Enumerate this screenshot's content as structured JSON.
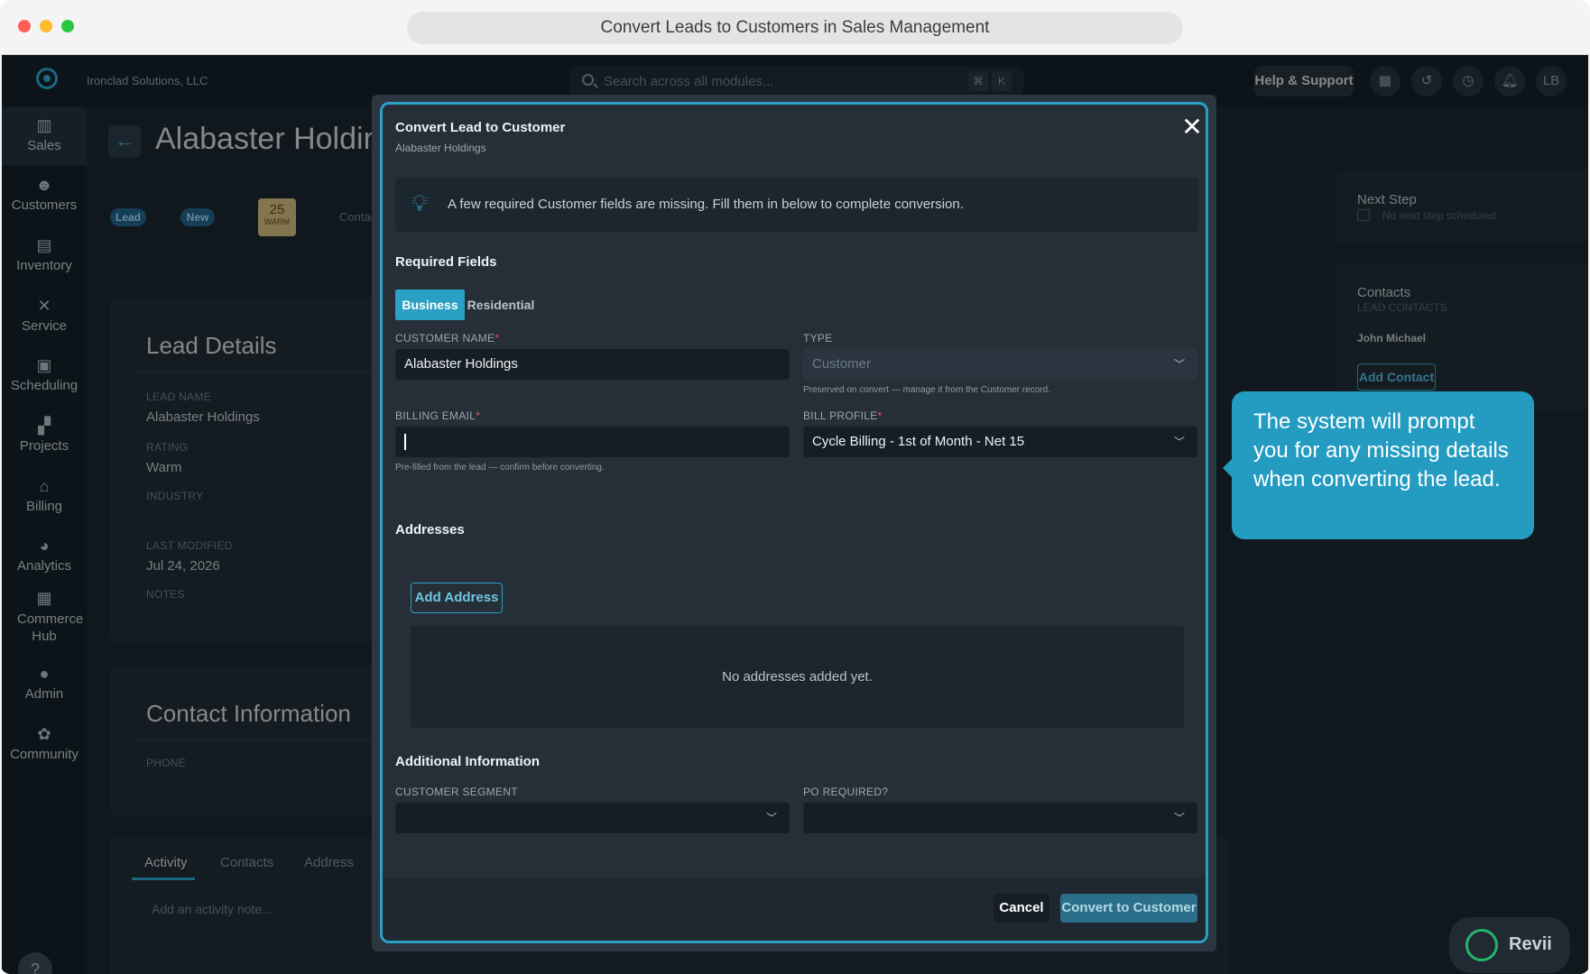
{
  "window": {
    "title": "Convert Leads to Customers in Sales Management"
  },
  "topbar": {
    "company": "Ironclad Solutions, LLC",
    "search_placeholder": "Search across all modules...",
    "kbd_cmd": "⌘",
    "kbd_k": "K",
    "help_label": "Help & Support",
    "avatar_initials": "LB"
  },
  "sidebar": {
    "items": [
      {
        "label": "Sales",
        "icon": "sales-icon"
      },
      {
        "label": "Customers",
        "icon": "customers-icon"
      },
      {
        "label": "Inventory",
        "icon": "inventory-icon"
      },
      {
        "label": "Service",
        "icon": "service-icon"
      },
      {
        "label": "Scheduling",
        "icon": "calendar-icon"
      },
      {
        "label": "Projects",
        "icon": "projects-icon"
      },
      {
        "label": "Billing",
        "icon": "bank-icon"
      },
      {
        "label": "Analytics",
        "icon": "pie-chart-icon"
      },
      {
        "label": "Commerce Hub",
        "icon": "store-icon"
      },
      {
        "label": "Admin",
        "icon": "admin-icon"
      },
      {
        "label": "Community",
        "icon": "community-icon"
      }
    ],
    "help": "?"
  },
  "page": {
    "title": "Alabaster Holdings",
    "badges": {
      "lead": "Lead",
      "new": "New"
    },
    "score": {
      "value": "25",
      "label": "WARM"
    },
    "contact_crumb": "Contac",
    "lead_details": {
      "title": "Lead Details",
      "lead_name_label": "LEAD NAME",
      "lead_name": "Alabaster Holdings",
      "rating_label": "RATING",
      "rating": "Warm",
      "industry_label": "INDUSTRY",
      "last_modified_label": "LAST MODIFIED",
      "last_modified": "Jul 24, 2026",
      "notes_label": "NOTES"
    },
    "contact_info": {
      "title": "Contact Information",
      "phone_label": "PHONE"
    },
    "tabs": [
      "Activity",
      "Contacts",
      "Address"
    ],
    "activity_placeholder": "Add an activity note..."
  },
  "right": {
    "next_step": {
      "title": "Next Step",
      "empty": "No next step scheduled."
    },
    "contacts": {
      "title": "Contacts",
      "sub": "LEAD CONTACTS",
      "name": "John Michael",
      "add_label": "Add Contact"
    }
  },
  "tooltip": {
    "text": "The system will prompt you for any missing details when converting the lead."
  },
  "revii": {
    "label": "Revii"
  },
  "modal": {
    "title": "Convert Lead to Customer",
    "subtitle": "Alabaster Holdings",
    "info": "A few required Customer fields are missing. Fill them in below to complete conversion.",
    "required_title": "Required Fields",
    "seg_business": "Business",
    "seg_residential": "Residential",
    "customer_name_label": "CUSTOMER NAME",
    "customer_name_value": "Alabaster Holdings",
    "type_label": "TYPE",
    "type_value": "Customer",
    "type_help": "Preserved on convert — manage it from the Customer record.",
    "billing_email_label": "BILLING EMAIL",
    "billing_email_help": "Pre-filled from the lead — confirm before converting.",
    "bill_profile_label": "BILL PROFILE",
    "bill_profile_value": "Cycle Billing - 1st of Month - Net 15",
    "addresses_title": "Addresses",
    "add_address": "Add Address",
    "no_addresses": "No addresses added yet.",
    "additional_title": "Additional Information",
    "segment_label": "CUSTOMER SEGMENT",
    "po_label": "PO REQUIRED?",
    "cancel": "Cancel",
    "convert": "Convert to Customer",
    "required_mark": "*"
  }
}
